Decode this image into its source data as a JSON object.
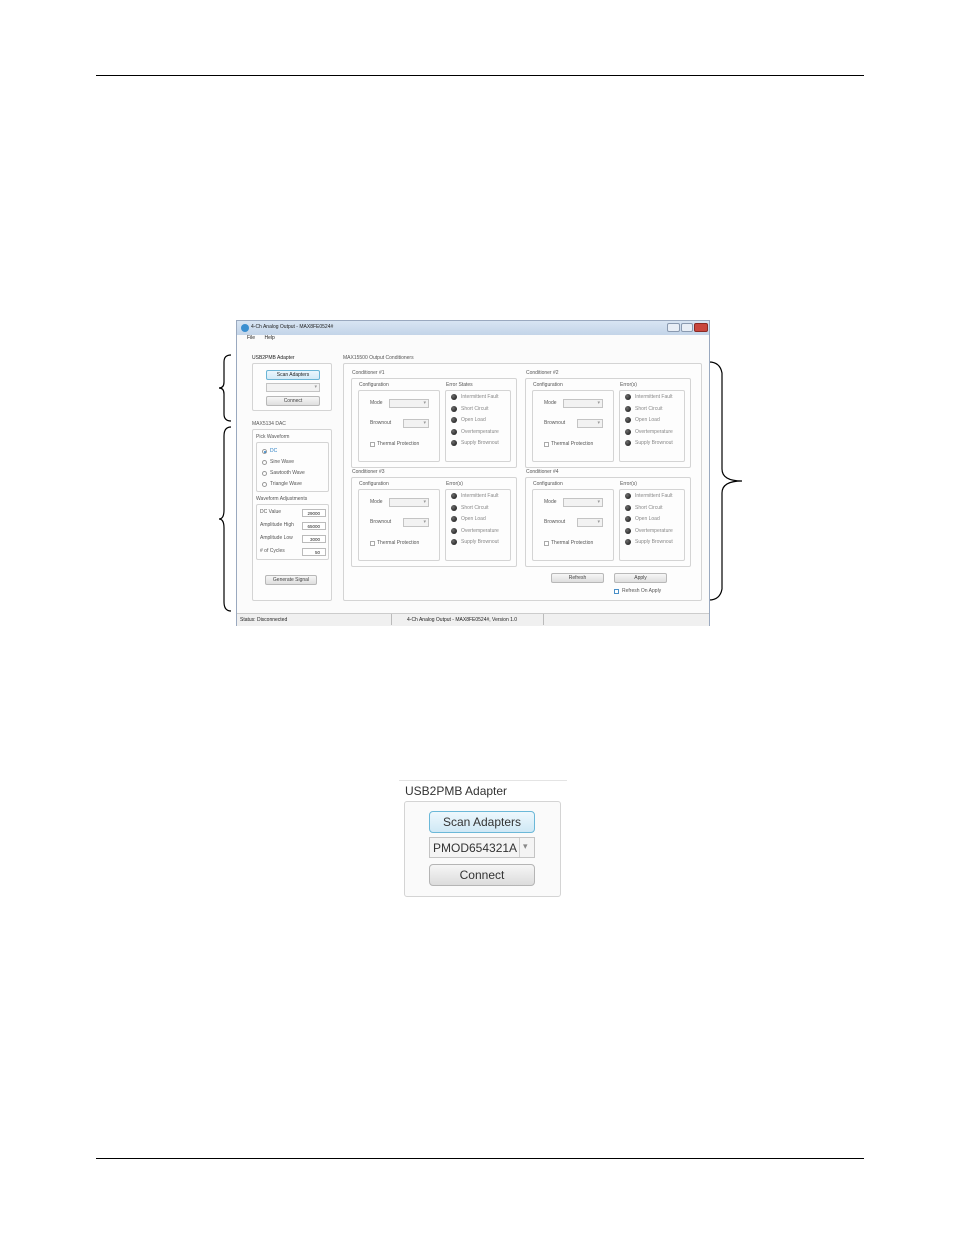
{
  "window": {
    "title": "4-Ch Analog Output - MAX8FE0524#",
    "menu": [
      "File",
      "Help"
    ],
    "adapter_group_title": "USB2PMB Adapter",
    "scan_label": "Scan Adapters",
    "adapter_combo_value": "",
    "connect_label": "Connect",
    "dac": {
      "group_title": "MAX5134 DAC",
      "waveform_title": "Pick Waveform",
      "waveforms": [
        {
          "label": "DC",
          "selected": true
        },
        {
          "label": "Sine Wave",
          "selected": false
        },
        {
          "label": "Sawtooth Wave",
          "selected": false
        },
        {
          "label": "Triangle Wave",
          "selected": false
        }
      ],
      "adjust_title": "Waveform Adjustments",
      "params": [
        {
          "label": "DC Value",
          "value": "29000"
        },
        {
          "label": "Amplitude High",
          "value": "65000"
        },
        {
          "label": "Amplitude Low",
          "value": "3000"
        },
        {
          "label": "# of Cycles",
          "value": "50"
        }
      ],
      "generate_label": "Generate Signal"
    },
    "conditioners_title": "MAX15500 Output Conditioners",
    "conditioners": [
      {
        "title": "Conditioner #1",
        "errors_title": "Error States"
      },
      {
        "title": "Conditioner #2",
        "errors_title": "Error(s)"
      },
      {
        "title": "Conditioner #3",
        "errors_title": "Error(s)"
      },
      {
        "title": "Conditioner #4",
        "errors_title": "Error(s)"
      }
    ],
    "config_title": "Configuration",
    "mode_label": "Mode",
    "brownout_label": "Brownout",
    "thermal_label": "Thermal Protection",
    "error_items": [
      "Intermittent Fault",
      "Short Circuit",
      "Open Load",
      "Overtemperature",
      "Supply Brownout"
    ],
    "refresh_label": "Refresh",
    "apply_label": "Apply",
    "refresh_on_apply_label": "Refresh On Apply",
    "status_text": "Status: Disconnected",
    "status_center": "4-Ch Analog Output - MAX8FE0524#,   Version 1.0"
  },
  "zoom": {
    "title": "USB2PMB Adapter",
    "scan_label": "Scan Adapters",
    "combo_value": "PMOD654321A",
    "connect_label": "Connect"
  }
}
